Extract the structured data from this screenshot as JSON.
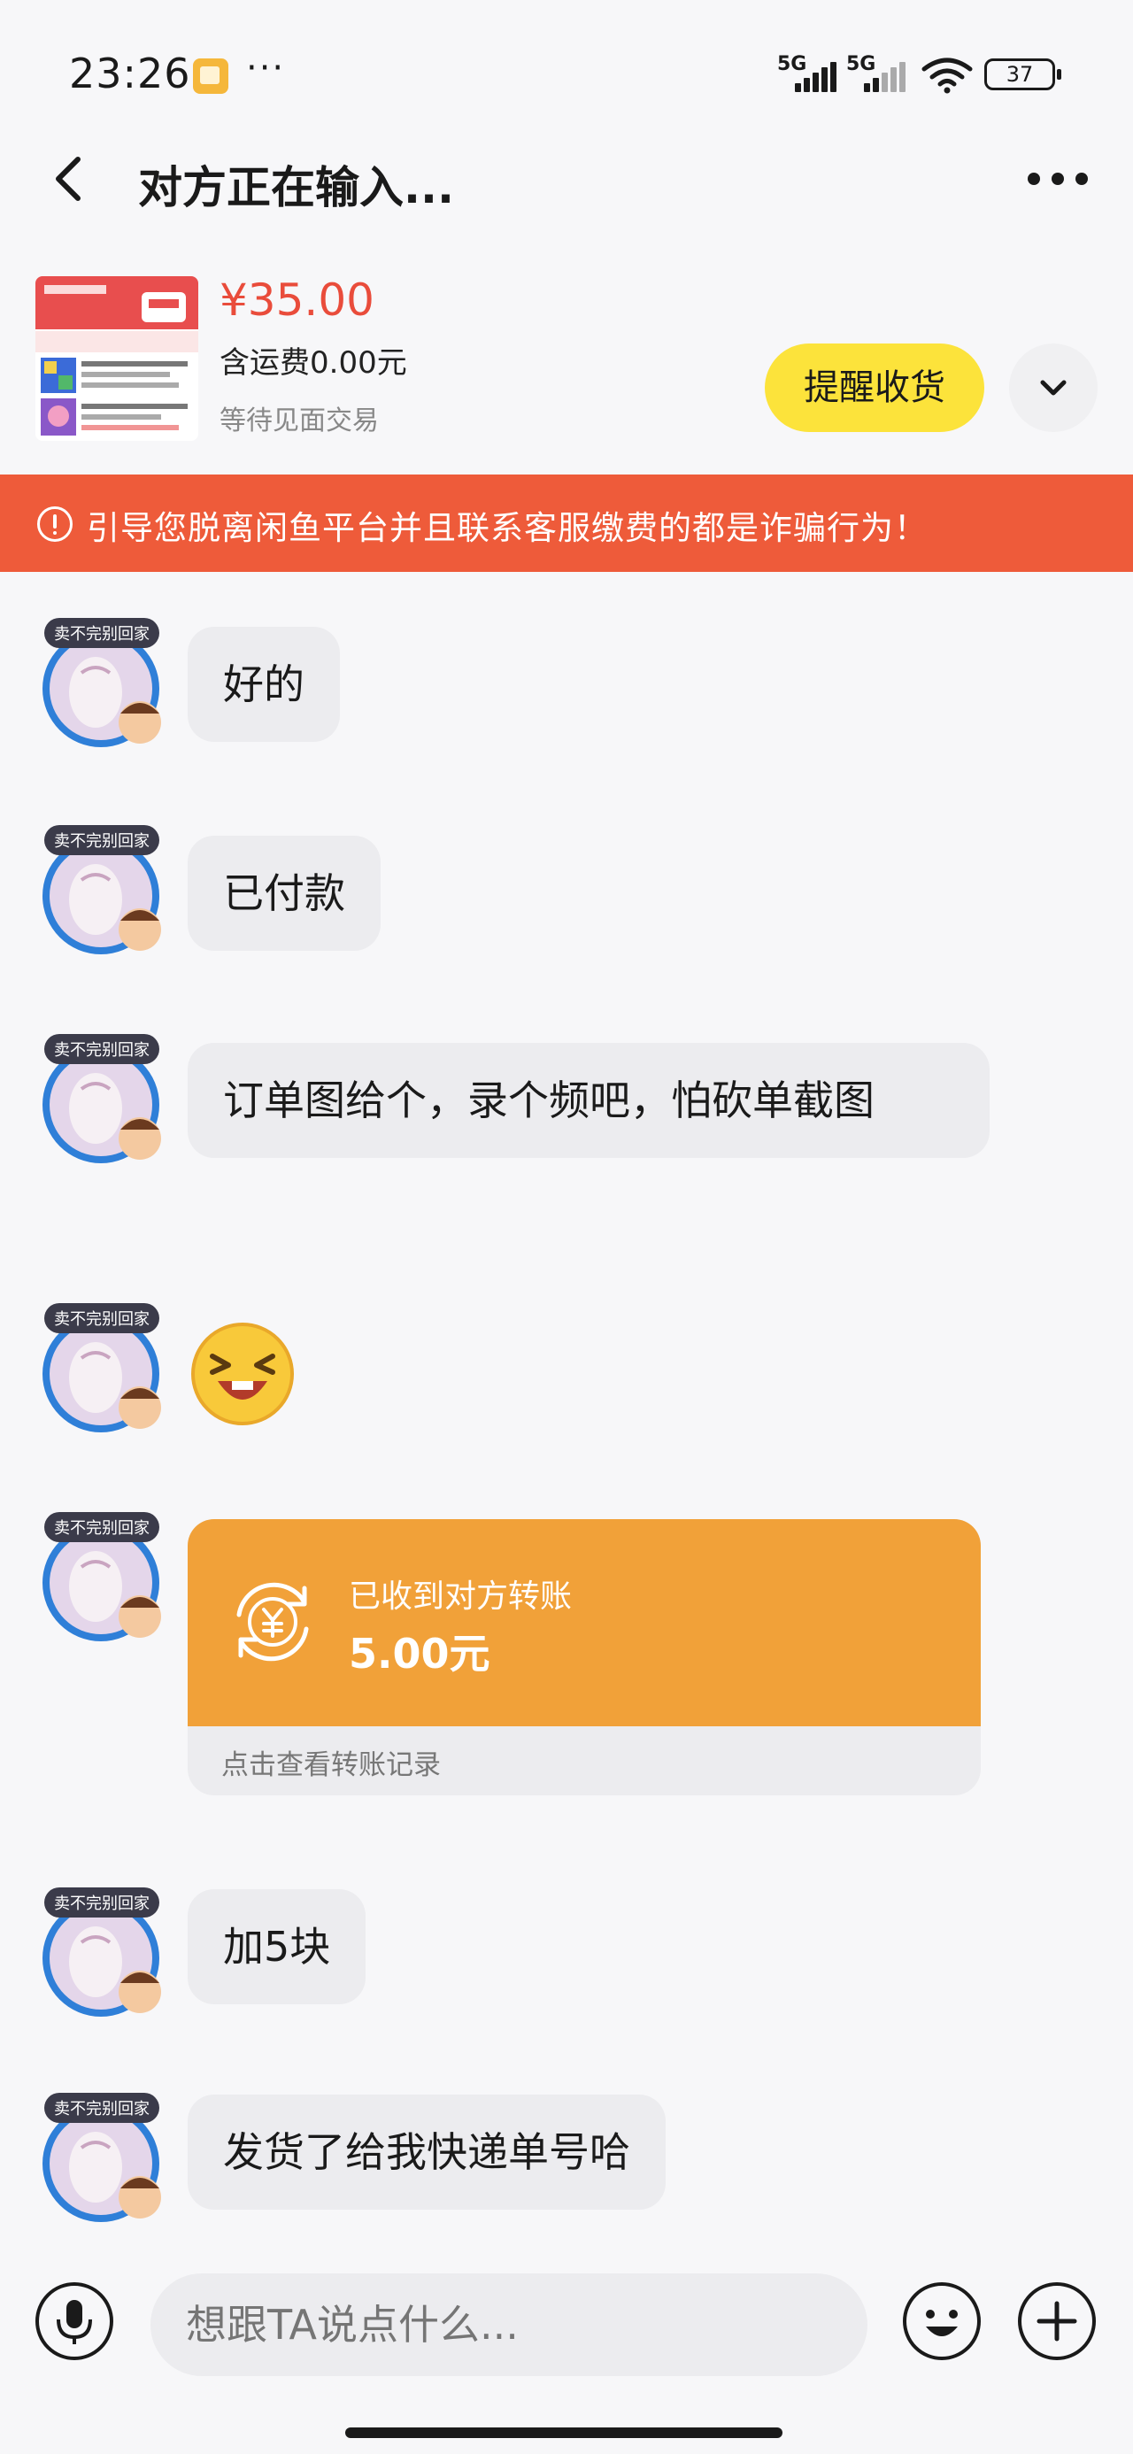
{
  "status_bar": {
    "time": "23:26",
    "dots": "···",
    "signal1_label": "5G",
    "signal2_label": "5G",
    "battery": "37"
  },
  "header": {
    "title": "对方正在输入..."
  },
  "product": {
    "price": "¥35.00",
    "shipping": "含运费0.00元",
    "status": "等待见面交易",
    "remind_label": "提醒收货"
  },
  "warning": {
    "text": "引导您脱离闲鱼平台并且联系客服缴费的都是诈骗行为！"
  },
  "avatar_badge": "卖不完别回家",
  "messages": [
    {
      "type": "text",
      "text": "好的"
    },
    {
      "type": "text",
      "text": "已付款"
    },
    {
      "type": "text",
      "text": "订单图给个，录个频吧，怕砍单截图"
    },
    {
      "type": "emoji",
      "icon": "laughing-emoji-icon"
    },
    {
      "type": "transfer",
      "label": "已收到对方转账",
      "amount": "5.00元",
      "link": "点击查看转账记录"
    },
    {
      "type": "text",
      "text": "加5块"
    },
    {
      "type": "text",
      "text": "发货了给我快递单号哈"
    }
  ],
  "input": {
    "placeholder": "想跟TA说点什么..."
  },
  "colors": {
    "accent_yellow": "#fce33b",
    "warning_red": "#ee5b3a",
    "price_red": "#e94c3b",
    "transfer_orange": "#f1a139"
  }
}
